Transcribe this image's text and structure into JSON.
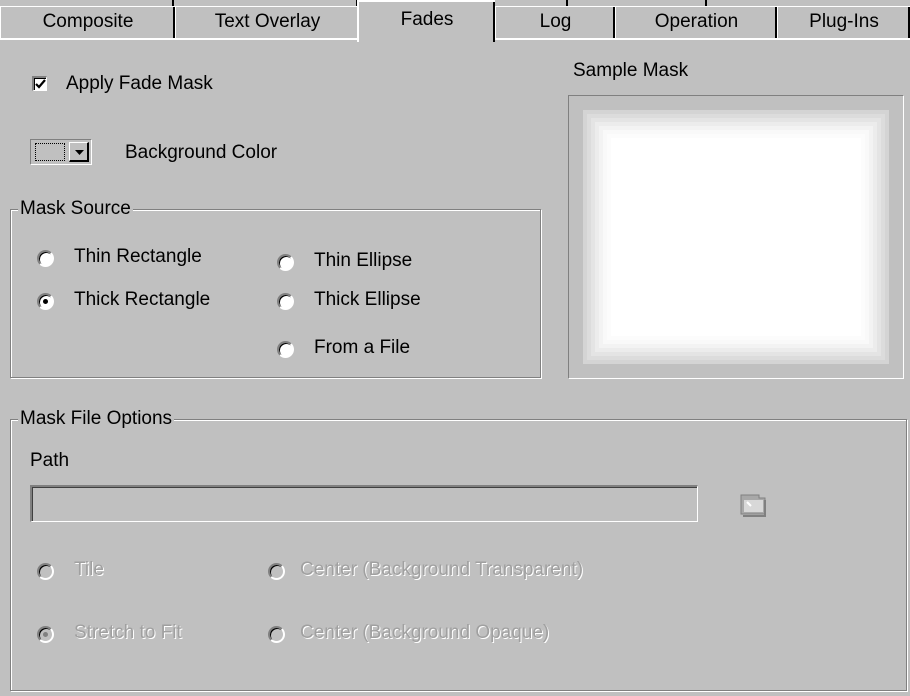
{
  "tabs": [
    {
      "label": "Composite",
      "active": false
    },
    {
      "label": "Text Overlay",
      "active": false
    },
    {
      "label": "Fades",
      "active": true
    },
    {
      "label": "Log",
      "active": false
    },
    {
      "label": "Operation",
      "active": false
    },
    {
      "label": "Plug-Ins",
      "active": false
    }
  ],
  "fades": {
    "apply_fade_mask": {
      "label": "Apply Fade Mask",
      "checked": true
    },
    "background_color": {
      "label": "Background Color",
      "icon": "chevron-down-icon"
    },
    "sample_mask_label": "Sample Mask",
    "mask_source": {
      "title": "Mask Source",
      "options": [
        {
          "label": "Thin Rectangle",
          "selected": false
        },
        {
          "label": "Thick Rectangle",
          "selected": true
        },
        {
          "label": "Thin Ellipse",
          "selected": false
        },
        {
          "label": "Thick Ellipse",
          "selected": false
        },
        {
          "label": "From a File",
          "selected": false
        }
      ]
    },
    "mask_file_options": {
      "title": "Mask File Options",
      "path_label": "Path",
      "path_value": "",
      "browse_icon": "folder-icon",
      "options": [
        {
          "label": "Tile",
          "selected": false,
          "enabled": false
        },
        {
          "label": "Stretch to Fit",
          "selected": true,
          "enabled": false
        },
        {
          "label": "Center (Background Transparent)",
          "selected": false,
          "enabled": false
        },
        {
          "label": "Center (Background Opaque)",
          "selected": false,
          "enabled": false
        }
      ]
    }
  }
}
